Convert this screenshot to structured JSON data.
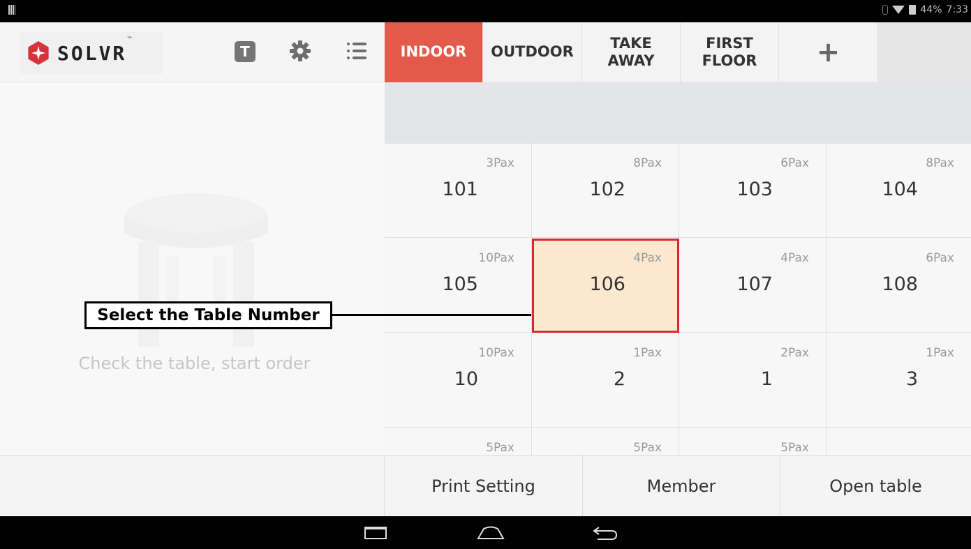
{
  "status_bar": {
    "battery": "44%",
    "time": "7:33"
  },
  "header": {
    "logo_text": "SOLVR",
    "logo_tm": "™",
    "t_label": "T"
  },
  "left_panel": {
    "empty_text": "Check the table, start order"
  },
  "tabs": [
    {
      "label_line1": "INDOOR",
      "label_line2": "",
      "active": true
    },
    {
      "label_line1": "OUTDOOR",
      "label_line2": "",
      "active": false
    },
    {
      "label_line1": "TAKE",
      "label_line2": "AWAY",
      "active": false
    },
    {
      "label_line1": "FIRST",
      "label_line2": "FLOOR",
      "active": false
    }
  ],
  "add_tab_label": "+",
  "tables": [
    {
      "number": "101",
      "pax": "3Pax"
    },
    {
      "number": "102",
      "pax": "8Pax"
    },
    {
      "number": "103",
      "pax": "6Pax"
    },
    {
      "number": "104",
      "pax": "8Pax"
    },
    {
      "number": "105",
      "pax": "10Pax"
    },
    {
      "number": "106",
      "pax": "4Pax",
      "selected": true
    },
    {
      "number": "107",
      "pax": "4Pax"
    },
    {
      "number": "108",
      "pax": "6Pax"
    },
    {
      "number": "10",
      "pax": "10Pax"
    },
    {
      "number": "2",
      "pax": "1Pax"
    },
    {
      "number": "1",
      "pax": "2Pax"
    },
    {
      "number": "3",
      "pax": "1Pax"
    },
    {
      "number": "",
      "pax": "5Pax"
    },
    {
      "number": "",
      "pax": "5Pax"
    },
    {
      "number": "",
      "pax": "5Pax"
    },
    {
      "number": "",
      "pax": ""
    }
  ],
  "bottom_bar": {
    "print_setting": "Print Setting",
    "member": "Member",
    "open_table": "Open table"
  },
  "annotation": {
    "callout": "Select the Table Number"
  },
  "colors": {
    "active_tab": "#e35a4b",
    "selected_cell": "#fde9cf",
    "highlight_border": "#e0262c"
  }
}
